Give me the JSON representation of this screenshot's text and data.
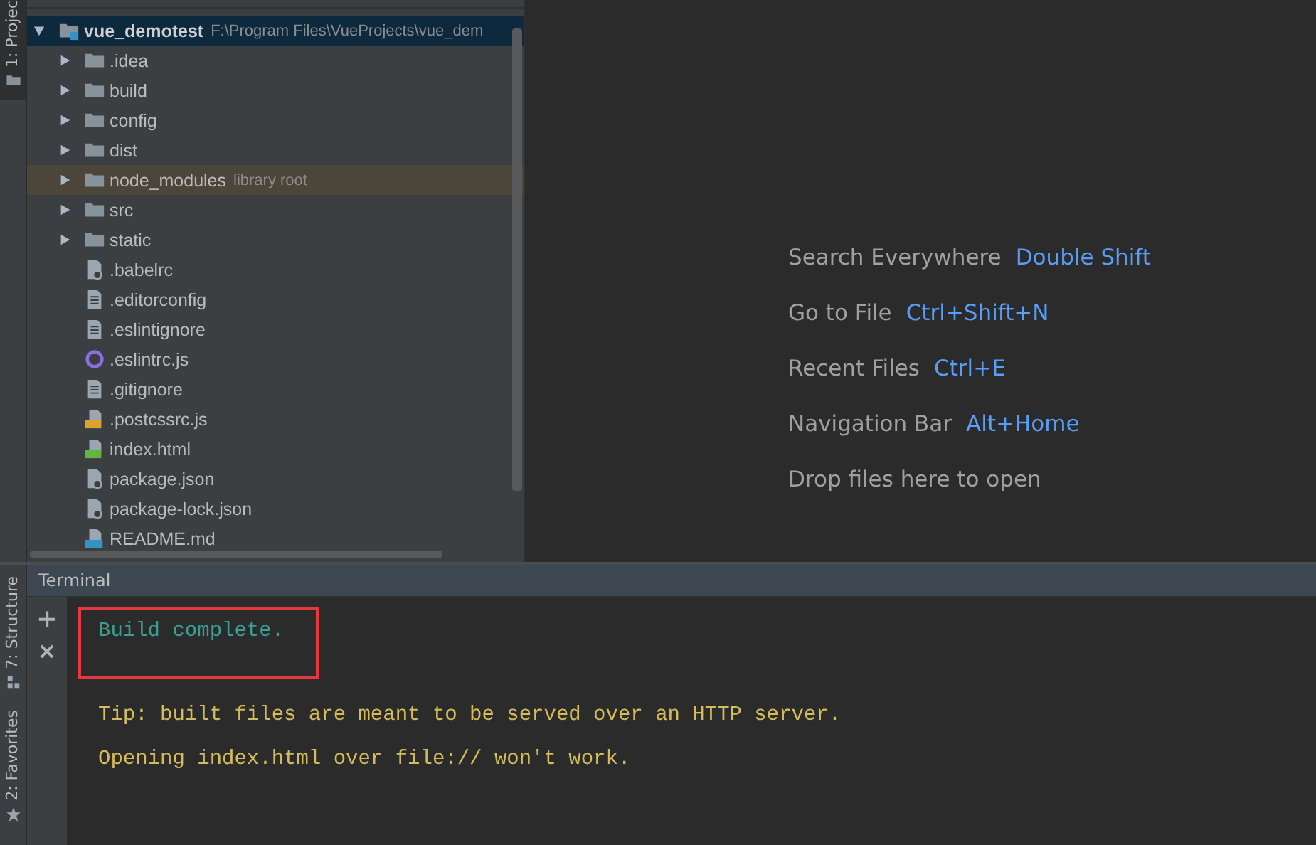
{
  "side_tabs_top": [
    {
      "label": "1: Projec",
      "selected": true
    }
  ],
  "side_tabs_bottom": [
    {
      "label": "7: Structure",
      "kind": "structure"
    },
    {
      "label": "2: Favorites",
      "kind": "favorites"
    }
  ],
  "project_tree": [
    {
      "name": "vue_demotest",
      "path": "F:\\Program Files\\VueProjects\\vue_dem",
      "kind": "module",
      "expanded": true,
      "selected": true,
      "children": [
        {
          "name": ".idea",
          "kind": "folder",
          "expanded": false
        },
        {
          "name": "build",
          "kind": "folder",
          "expanded": false
        },
        {
          "name": "config",
          "kind": "folder",
          "expanded": false
        },
        {
          "name": "dist",
          "kind": "folder",
          "expanded": false
        },
        {
          "name": "node_modules",
          "hint": "library root",
          "kind": "folder",
          "expanded": false,
          "library": true
        },
        {
          "name": "src",
          "kind": "folder",
          "expanded": false
        },
        {
          "name": "static",
          "kind": "folder",
          "expanded": false
        },
        {
          "name": ".babelrc",
          "kind": "config"
        },
        {
          "name": ".editorconfig",
          "kind": "text"
        },
        {
          "name": ".eslintignore",
          "kind": "text"
        },
        {
          "name": ".eslintrc.js",
          "kind": "eslint"
        },
        {
          "name": ".gitignore",
          "kind": "text"
        },
        {
          "name": ".postcssrc.js",
          "kind": "js"
        },
        {
          "name": "index.html",
          "kind": "html"
        },
        {
          "name": "package.json",
          "kind": "config"
        },
        {
          "name": "package-lock.json",
          "kind": "config"
        },
        {
          "name": "README.md",
          "kind": "md"
        }
      ]
    }
  ],
  "editor_hints": [
    {
      "label": "Search Everywhere",
      "shortcut": "Double Shift"
    },
    {
      "label": "Go to File",
      "shortcut": "Ctrl+Shift+N"
    },
    {
      "label": "Recent Files",
      "shortcut": "Ctrl+E"
    },
    {
      "label": "Navigation Bar",
      "shortcut": "Alt+Home"
    },
    {
      "label": "Drop files here to open"
    }
  ],
  "terminal": {
    "title": "Terminal",
    "actions": [
      {
        "kind": "add",
        "symbol": "+"
      },
      {
        "kind": "close",
        "symbol": "×"
      }
    ],
    "lines": [
      {
        "text": "Build complete.",
        "kind": "success",
        "highlighted": true
      },
      {
        "text": "Tip: built files are meant to be served over an HTTP server.",
        "kind": "warning",
        "highlighted": false
      },
      {
        "text": "Opening index.html over file:// won't work.",
        "kind": "warning",
        "highlighted": false
      }
    ]
  }
}
